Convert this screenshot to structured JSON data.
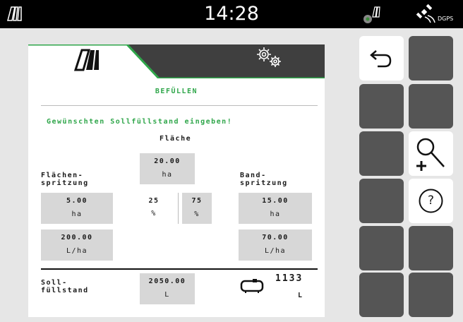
{
  "topbar": {
    "clock": "14:28",
    "icons": [
      "field-icon",
      "machine-status-icon",
      "satellite-icon"
    ],
    "dgps_label": "DGPS"
  },
  "panel": {
    "tabs": [
      {
        "icon": "field-icon",
        "active": true
      },
      {
        "icon": "gears-icon",
        "active": false
      }
    ],
    "title": "BEFÜLLEN",
    "instruction": "Gewünschten Sollfüllstand eingeben!",
    "flaeche": {
      "label": "Fläche",
      "value": "20.00",
      "unit": "ha"
    },
    "flaechen_spritzung": {
      "label_line1": "Flächen-",
      "label_line2": "spritzung",
      "area": {
        "value": "5.00",
        "unit": "ha"
      },
      "rate": {
        "value": "200.00",
        "unit": "L/ha"
      }
    },
    "band_spritzung": {
      "label_line1": "Band-",
      "label_line2": "spritzung",
      "area": {
        "value": "15.00",
        "unit": "ha"
      },
      "rate": {
        "value": "70.00",
        "unit": "L/ha"
      }
    },
    "percent_left": {
      "value": "25",
      "unit": "%"
    },
    "percent_right": {
      "value": "75",
      "unit": "%"
    },
    "sollfuellstand": {
      "label_line1": "Soll-",
      "label_line2": "füllstand",
      "value": "2050.00",
      "unit": "L"
    },
    "tank": {
      "icon": "tank-icon",
      "value": "1133",
      "unit": "L"
    }
  },
  "side_buttons": [
    {
      "name": "back",
      "icon": "back-arrow-icon"
    },
    {
      "name": "zoom",
      "icon": "zoom-in-icon"
    },
    {
      "name": "help",
      "icon": "help-icon",
      "label": "?"
    }
  ],
  "colors": {
    "accent": "#2fa64a",
    "tab_inactive": "#3f3f3f",
    "button_dark": "#555555",
    "input_bg": "#d7d7d7"
  }
}
